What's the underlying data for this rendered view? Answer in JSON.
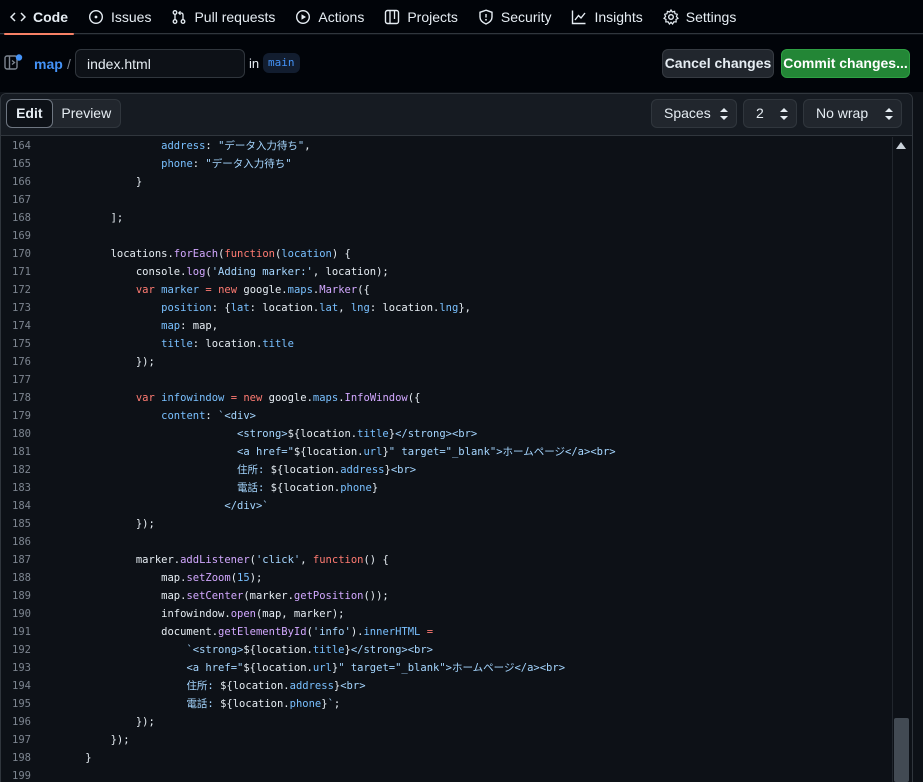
{
  "nav": {
    "items": [
      {
        "label": "Code",
        "icon": "code-icon",
        "selected": true
      },
      {
        "label": "Issues",
        "icon": "issue-icon"
      },
      {
        "label": "Pull requests",
        "icon": "pull-request-icon"
      },
      {
        "label": "Actions",
        "icon": "play-icon"
      },
      {
        "label": "Projects",
        "icon": "table-icon"
      },
      {
        "label": "Security",
        "icon": "shield-icon"
      },
      {
        "label": "Insights",
        "icon": "graph-icon"
      },
      {
        "label": "Settings",
        "icon": "gear-icon"
      }
    ]
  },
  "file": {
    "repo": "map",
    "separator": "/",
    "filename": "index.html",
    "in_label": "in",
    "branch": "main"
  },
  "actions": {
    "cancel": "Cancel changes",
    "commit": "Commit changes..."
  },
  "toolbar": {
    "edit": "Edit",
    "preview": "Preview",
    "indent_mode": "Spaces",
    "indent_size": "2",
    "wrap_mode": "No wrap"
  },
  "code": {
    "lines": [
      {
        "n": "164",
        "html": "                <span class=\"p\">address</span>: <span class=\"s\">\"データ入力待ち\"</span>,"
      },
      {
        "n": "165",
        "html": "                <span class=\"p\">phone</span>: <span class=\"s\">\"データ入力待ち\"</span>"
      },
      {
        "n": "166",
        "html": "            }"
      },
      {
        "n": "167",
        "html": ""
      },
      {
        "n": "168",
        "html": "        ];"
      },
      {
        "n": "169",
        "html": ""
      },
      {
        "n": "170",
        "html": "        locations.<span class=\"f\">forEach</span>(<span class=\"k\">function</span>(<span class=\"p\">location</span>) {"
      },
      {
        "n": "171",
        "html": "            console.<span class=\"f\">log</span>(<span class=\"s\">'Adding marker:'</span>, location);"
      },
      {
        "n": "172",
        "html": "            <span class=\"k\">var</span> <span class=\"p\">marker</span> <span class=\"k\">=</span> <span class=\"k\">new</span> google.<span class=\"p\">maps</span>.<span class=\"f\">Marker</span>({"
      },
      {
        "n": "173",
        "html": "                <span class=\"p\">position</span>: {<span class=\"p\">lat</span>: location.<span class=\"p\">lat</span>, <span class=\"p\">lng</span>: location.<span class=\"p\">lng</span>},"
      },
      {
        "n": "174",
        "html": "                <span class=\"p\">map</span>: map,"
      },
      {
        "n": "175",
        "html": "                <span class=\"p\">title</span>: location.<span class=\"p\">title</span>"
      },
      {
        "n": "176",
        "html": "            });"
      },
      {
        "n": "177",
        "html": ""
      },
      {
        "n": "178",
        "html": "            <span class=\"k\">var</span> <span class=\"p\">infowindow</span> <span class=\"k\">=</span> <span class=\"k\">new</span> google.<span class=\"p\">maps</span>.<span class=\"f\">InfoWindow</span>({"
      },
      {
        "n": "179",
        "html": "                <span class=\"p\">content</span>: <span class=\"s\">`&lt;div&gt;</span>"
      },
      {
        "n": "180",
        "html": "                            <span class=\"s\">&lt;strong&gt;</span>${location.<span class=\"p\">title</span>}<span class=\"s\">&lt;/strong&gt;&lt;br&gt;</span>"
      },
      {
        "n": "181",
        "html": "                            <span class=\"s\">&lt;a href=\"</span>${location.<span class=\"p\">url</span>}<span class=\"s\">\" target=\"_blank\"&gt;ホームページ&lt;/a&gt;&lt;br&gt;</span>"
      },
      {
        "n": "182",
        "html": "                            <span class=\"s\">住所: </span>${location.<span class=\"p\">address</span>}<span class=\"s\">&lt;br&gt;</span>"
      },
      {
        "n": "183",
        "html": "                            <span class=\"s\">電話: </span>${location.<span class=\"p\">phone</span>}"
      },
      {
        "n": "184",
        "html": "                          <span class=\"s\">&lt;/div&gt;`</span>"
      },
      {
        "n": "185",
        "html": "            });"
      },
      {
        "n": "186",
        "html": ""
      },
      {
        "n": "187",
        "html": "            marker.<span class=\"f\">addListener</span>(<span class=\"s\">'click'</span>, <span class=\"k\">function</span>() {"
      },
      {
        "n": "188",
        "html": "                map.<span class=\"f\">setZoom</span>(<span class=\"p\">15</span>);"
      },
      {
        "n": "189",
        "html": "                map.<span class=\"f\">setCenter</span>(marker.<span class=\"f\">getPosition</span>());"
      },
      {
        "n": "190",
        "html": "                infowindow.<span class=\"f\">open</span>(map, marker);"
      },
      {
        "n": "191",
        "html": "                document.<span class=\"f\">getElementById</span>(<span class=\"s\">'info'</span>).<span class=\"p\">innerHTML</span> <span class=\"k\">=</span>"
      },
      {
        "n": "192",
        "html": "                    <span class=\"s\">`&lt;strong&gt;</span>${location.<span class=\"p\">title</span>}<span class=\"s\">&lt;/strong&gt;&lt;br&gt;</span>"
      },
      {
        "n": "193",
        "html": "                    <span class=\"s\">&lt;a href=\"</span>${location.<span class=\"p\">url</span>}<span class=\"s\">\" target=\"_blank\"&gt;ホームページ&lt;/a&gt;&lt;br&gt;</span>"
      },
      {
        "n": "194",
        "html": "                    <span class=\"s\">住所: </span>${location.<span class=\"p\">address</span>}<span class=\"s\">&lt;br&gt;</span>"
      },
      {
        "n": "195",
        "html": "                    <span class=\"s\">電話: </span>${location.<span class=\"p\">phone</span>}<span class=\"s\">`</span>;"
      },
      {
        "n": "196",
        "html": "            });"
      },
      {
        "n": "197",
        "html": "        });"
      },
      {
        "n": "198",
        "html": "    }"
      },
      {
        "n": "199",
        "html": ""
      }
    ]
  }
}
